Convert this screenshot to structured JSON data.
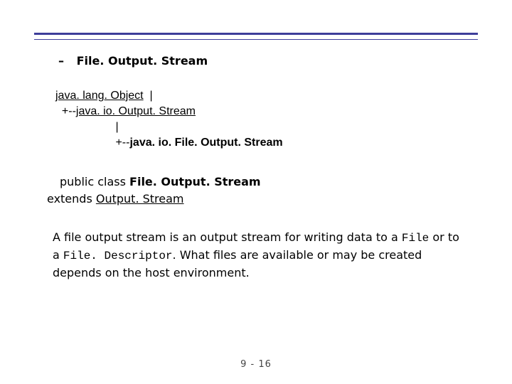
{
  "heading": {
    "dash": "–",
    "title": "File. Output. Stream"
  },
  "hierarchy": {
    "root": "java. lang. Object",
    "branch1_prefix": "  |\n  +--",
    "branch1": "java. io. Output. Stream",
    "branch2_prefix": "\n                   |\n                   +--",
    "branch2": "java. io. File. Output. Stream"
  },
  "decl": {
    "public_class": "public class ",
    "classname": "File. Output. Stream",
    "extends": "extends ",
    "superlink": "Output. Stream"
  },
  "desc": {
    "p1a": "A file output stream is an output stream for writing data to a ",
    "code1": "File",
    "p1b": " or to a ",
    "code2": "File. Descriptor",
    "p1c": ". What files are available or may be created depends on the host environment."
  },
  "footer": "9 - 16"
}
